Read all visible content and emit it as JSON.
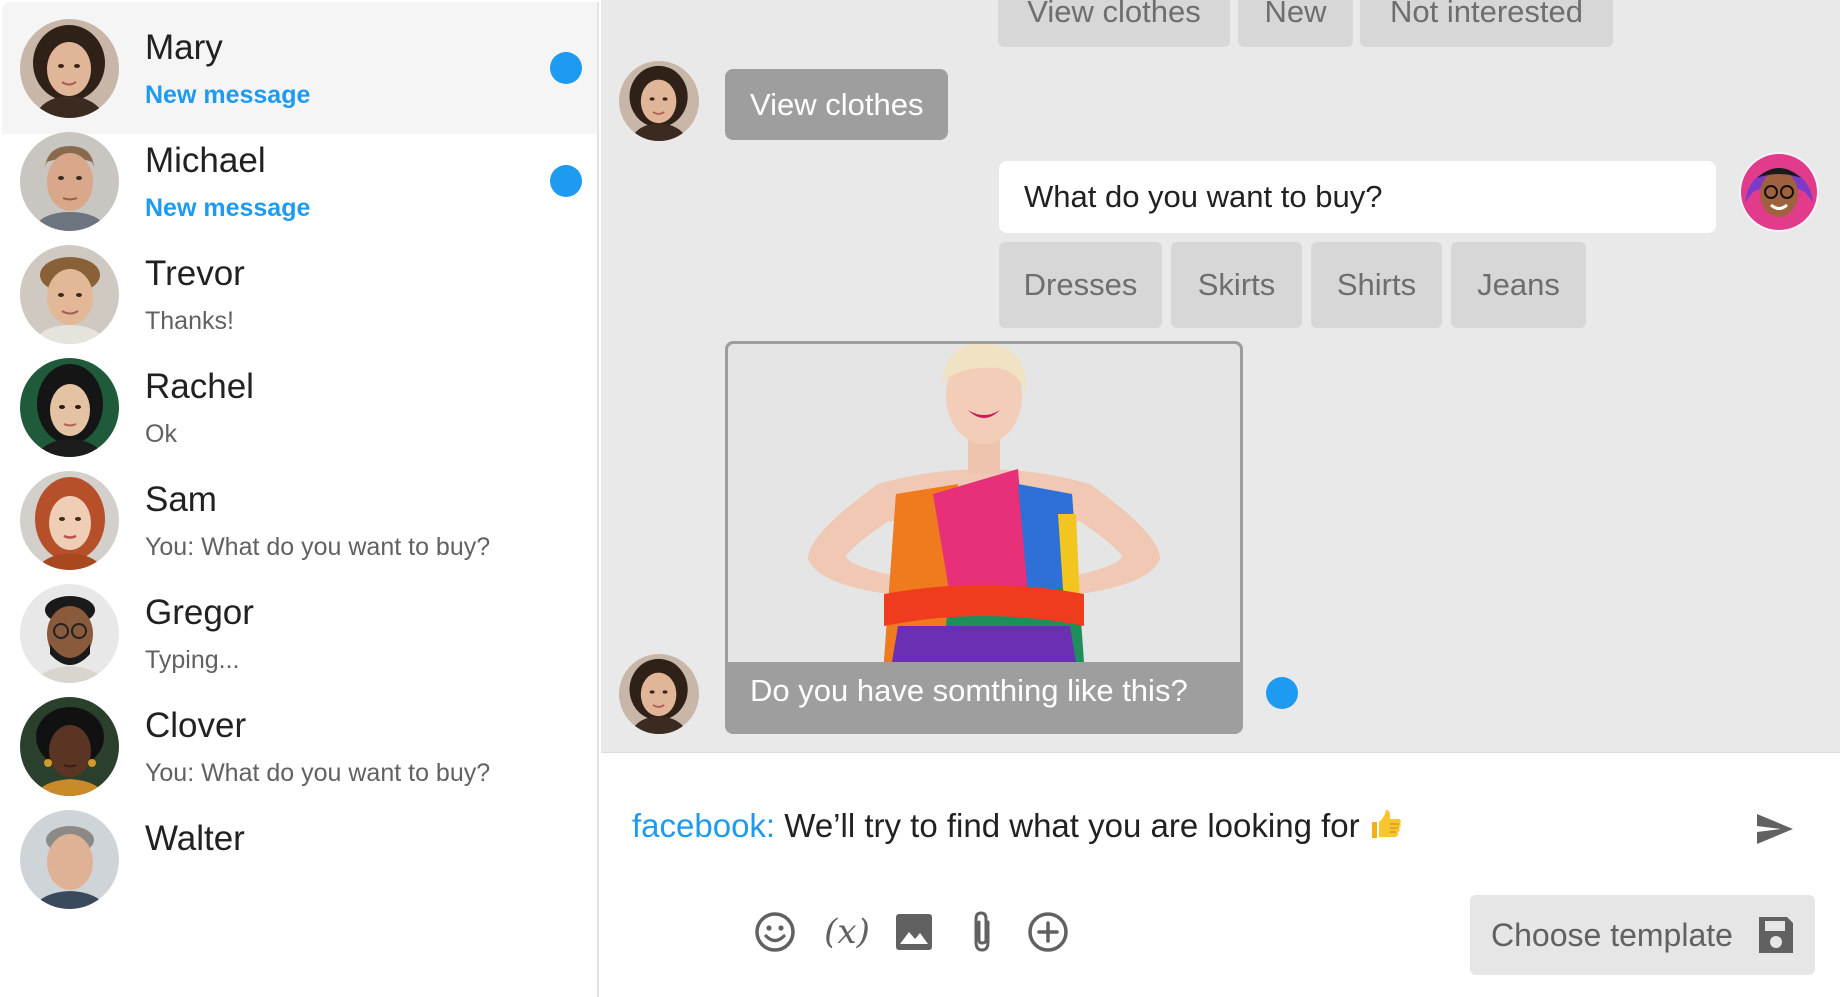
{
  "sidebar": {
    "contacts": [
      {
        "name": "Mary",
        "preview": "New message",
        "unread": true,
        "active": true
      },
      {
        "name": "Michael",
        "preview": "New message",
        "unread": true,
        "active": false
      },
      {
        "name": "Trevor",
        "preview": "Thanks!",
        "unread": false,
        "active": false
      },
      {
        "name": "Rachel",
        "preview": "Ok",
        "unread": false,
        "active": false
      },
      {
        "name": "Sam",
        "preview": "You: What do you want to buy?",
        "unread": false,
        "active": false
      },
      {
        "name": "Gregor",
        "preview": "Typing...",
        "unread": false,
        "active": false
      },
      {
        "name": "Clover",
        "preview": "You: What do you want to buy?",
        "unread": false,
        "active": false
      },
      {
        "name": "Walter",
        "preview": "",
        "unread": false,
        "active": false
      }
    ]
  },
  "chat": {
    "top_quick_replies": [
      "View clothes",
      "New",
      "Not interested"
    ],
    "user_reply": "View clothes",
    "bot_question": "What do you want to buy?",
    "category_options": [
      "Dresses",
      "Skirts",
      "Shirts",
      "Jeans"
    ],
    "image_caption": "Do you have somthing like this?"
  },
  "composer": {
    "channel": "facebook:",
    "draft": "We’ll try to find what you are looking for",
    "draft_emoji": "👍",
    "template_label": "Choose template"
  },
  "icons": {
    "send": "send-icon",
    "emoji": "emoji-icon",
    "variable": "variable-icon",
    "variable_glyph": "(x)",
    "image": "image-icon",
    "attachment": "paperclip-icon",
    "add": "add-circle-icon",
    "save": "save-icon"
  },
  "colors": {
    "accent": "#1e9bf0",
    "chat_background": "#e9e9e9",
    "quick_reply": "#d7d7d7",
    "user_bubble": "#9e9e9e"
  }
}
